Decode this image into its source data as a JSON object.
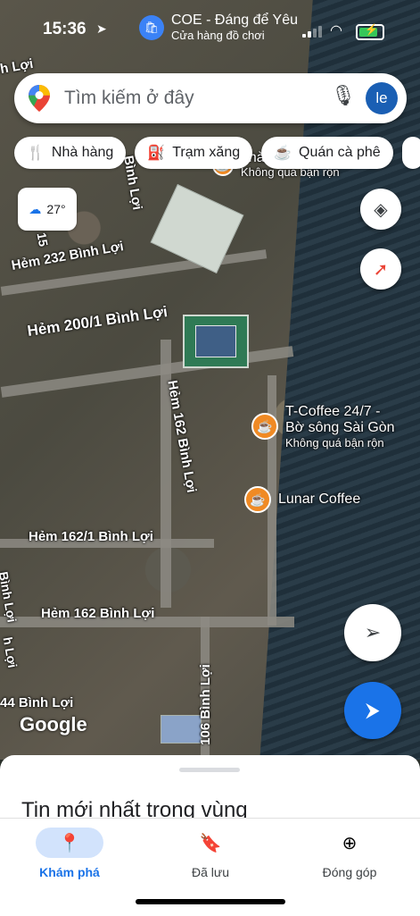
{
  "status_bar": {
    "time": "15:36",
    "notification_title": "COE - Đáng để Yêu",
    "notification_subtitle": "Cửa hàng đồ chơi"
  },
  "search": {
    "placeholder": "Tìm kiếm ở đây",
    "avatar_initials": "le"
  },
  "chips": [
    {
      "label": "Nhà hàng",
      "icon": "fork-knife-icon"
    },
    {
      "label": "Trạm xăng",
      "icon": "gas-station-icon"
    },
    {
      "label": "Quán cà phê",
      "icon": "coffee-cup-icon"
    }
  ],
  "weather": {
    "temp": "27°"
  },
  "map": {
    "street_labels": [
      "Hẻm 232 Bình Lợi",
      "Hẻm 200/1 Bình Lợi",
      "Hẻm 162 Bình Lợi",
      "Hẻm 162/1 Bình Lợi",
      "Hẻm 162 Bình Lợi",
      "44 Bình Lợi",
      "106 Bình Lợi",
      "h Lợi",
      "Bình Lợi",
      "15",
      "Bình Lợi",
      "h Lợi"
    ],
    "pois": [
      {
        "name": "T-Coffee 24/7 -",
        "name2": "Bờ sông Sài Gòn",
        "sub": "Không quá bận rộn"
      },
      {
        "name": "Lunar Coffee"
      }
    ],
    "top_poi_fragment": {
      "name": "nhà",
      "sub": "Không quá bận rộn"
    },
    "watermark": "Google"
  },
  "sheet": {
    "title": "Tin mới nhất trong vùng"
  },
  "nav": [
    {
      "label": "Khám phá",
      "icon": "explore-pin-icon",
      "active": true
    },
    {
      "label": "Đã lưu",
      "icon": "bookmark-icon",
      "active": false
    },
    {
      "label": "Đóng góp",
      "icon": "plus-circle-icon",
      "active": false
    }
  ],
  "colors": {
    "accent": "#1a73e8",
    "poi": "#f08a24"
  }
}
